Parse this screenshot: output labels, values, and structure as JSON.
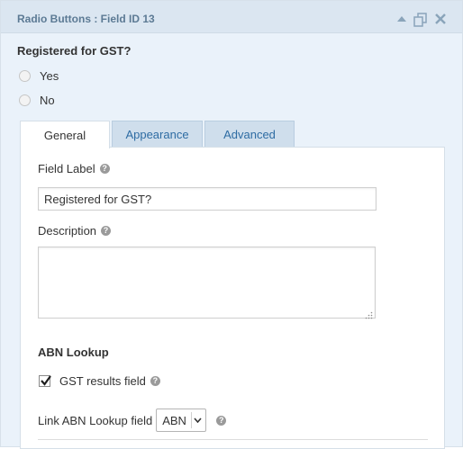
{
  "header": {
    "title": "Radio Buttons : Field ID 13",
    "icons": [
      "collapse-up-icon",
      "duplicate-icon",
      "close-icon"
    ]
  },
  "preview": {
    "label": "Registered for GST?",
    "choices": [
      "Yes",
      "No"
    ]
  },
  "tabs": [
    {
      "label": "General",
      "active": true
    },
    {
      "label": "Appearance",
      "active": false
    },
    {
      "label": "Advanced",
      "active": false
    }
  ],
  "general": {
    "field_label_title": "Field Label",
    "field_label_value": "Registered for GST?",
    "description_title": "Description",
    "description_value": "",
    "abn_section_title": "ABN Lookup",
    "gst_checkbox_label": "GST results field",
    "gst_checkbox_checked": true,
    "link_label": "Link ABN Lookup field",
    "link_selected": "ABN"
  },
  "colors": {
    "panel_bg": "#eaf2fa",
    "titlebar_bg": "#dbe6f1",
    "title_text": "#5c7a94",
    "tab_link": "#2e6ca3",
    "tab_inactive_bg": "#cfdeec"
  }
}
